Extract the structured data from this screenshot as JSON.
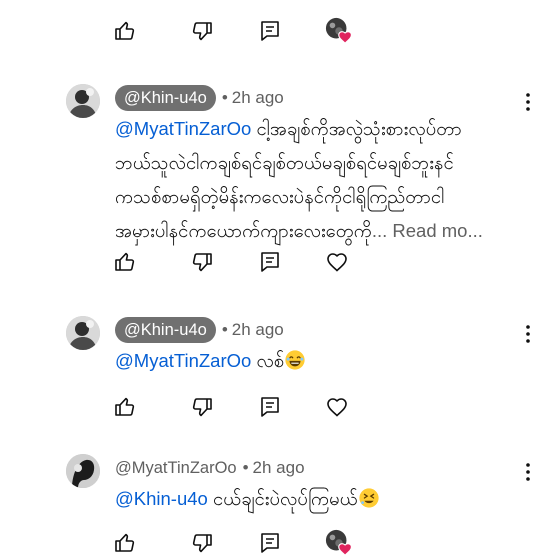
{
  "comments": [
    {
      "handle": "@Khin-u4o",
      "time": "2h ago",
      "mention": "@MyatTinZarOo",
      "line1": " ငါ့အချစ်ကိုအလွဲသုံးစားလုပ်တာ",
      "line2": "ဘယ်သူလဲငါကချစ်ရင်ချစ်တယ်မချစ်ရင်မချစ်ဘူးနင်",
      "line3": "ကသစ်စာမရှိတဲ့မိန်းကလေးပဲနင်ကိုငါရိုကြည်တာငါ",
      "line4": "အမှားပါနင်ကယောက်ကျားလေးတွေကို",
      "read_more": "... Read mo..."
    },
    {
      "handle": "@Khin-u4o",
      "time": "2h ago",
      "mention": "@MyatTinZarOo",
      "text": " လစ်"
    },
    {
      "handle": "@MyatTinZarOo",
      "time": "2h ago",
      "mention": "@Khin-u4o",
      "text": " ငယ်ချင်းပဲလုပ်ကြမယ်"
    }
  ],
  "separator": "•",
  "icons": {
    "like": "thumbs-up-icon",
    "dislike": "thumbs-down-icon",
    "reply": "reply-icon",
    "heart": "heart-icon",
    "more": "more-vert-icon",
    "hearted_by_creator": "creator-heart-badge"
  },
  "colors": {
    "mention": "#065fd4",
    "chip_bg": "#707070",
    "heart": "#e0245e",
    "secondary_text": "#606060"
  }
}
